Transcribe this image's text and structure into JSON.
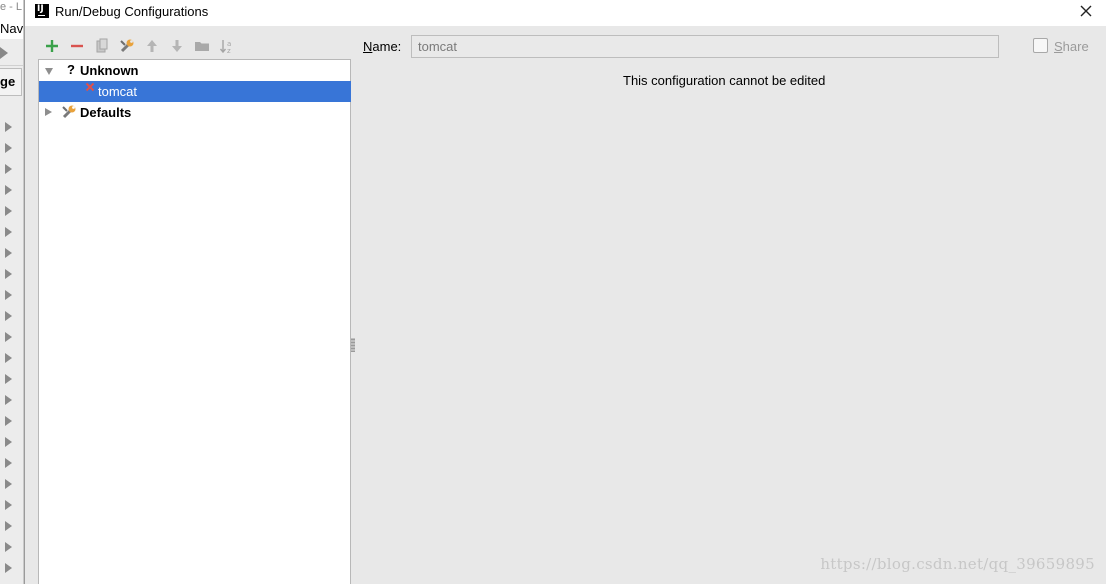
{
  "background_window": {
    "title_fragment": "e - L",
    "menu_fragment": "Navig",
    "breadcrumb_fragment": "ge"
  },
  "dialog": {
    "title": "Run/Debug Configurations",
    "app_icon_text": "IJ"
  },
  "toolbar": {
    "buttons": [
      {
        "icon": "add-icon",
        "tooltip": ""
      },
      {
        "icon": "remove-icon"
      },
      {
        "icon": "copy-icon"
      },
      {
        "icon": "edit-defaults-icon"
      },
      {
        "icon": "move-up-icon"
      },
      {
        "icon": "move-down-icon"
      },
      {
        "icon": "folder-icon"
      },
      {
        "icon": "sort-icon"
      }
    ]
  },
  "tree": {
    "groups": [
      {
        "label": "Unknown",
        "icon": "question-icon",
        "expanded": true,
        "children": [
          {
            "label": "tomcat",
            "icon": "error-config-icon",
            "selected": true
          }
        ]
      },
      {
        "label": "Defaults",
        "icon": "wrench-icon",
        "expanded": false
      }
    ]
  },
  "form": {
    "name_label_mnemonic": "N",
    "name_label_rest": "ame:",
    "name_value": "tomcat",
    "share_label_mnemonic": "S",
    "share_label_rest": "hare",
    "share_checked": false,
    "message": "This configuration cannot be edited"
  },
  "watermark": "https://blog.csdn.net/qq_39659895",
  "colors": {
    "selection": "#3875d7",
    "add_green": "#3aa14a",
    "remove_red": "#d9534f",
    "dialog_bg": "#e8e8e8"
  }
}
